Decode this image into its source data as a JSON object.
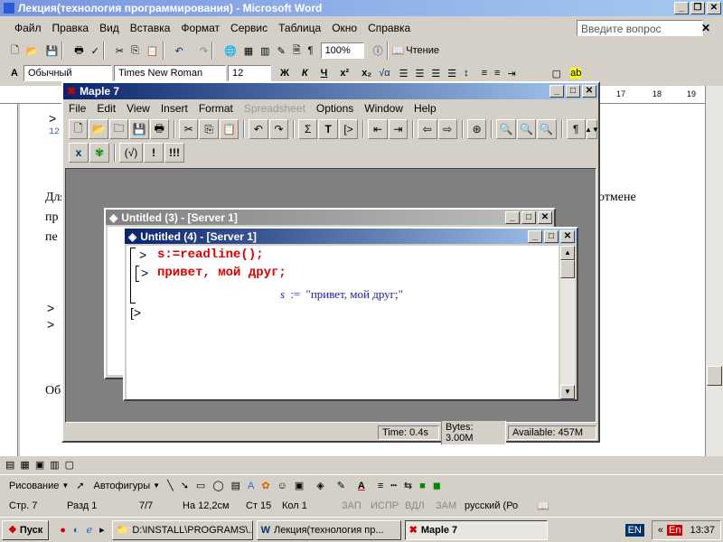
{
  "word": {
    "title": "Лекция(технология программирования) - Microsoft Word",
    "menu": [
      "Файл",
      "Правка",
      "Вид",
      "Вставка",
      "Формат",
      "Сервис",
      "Таблица",
      "Окно",
      "Справка"
    ],
    "ask_placeholder": "Введите вопрос",
    "zoom": "100%",
    "read_label": "Чтение",
    "style": "Обычный",
    "font": "Times New Roman",
    "size": "12",
    "fmt": {
      "bold": "Ж",
      "italic": "К",
      "underline": "Ч"
    },
    "ruler_nums": [
      "17",
      "18",
      "19"
    ],
    "doc": {
      "frag1": "отмене",
      "frag2": "пр",
      "frag3": "пе",
      "frag4": "Для",
      "frag5": "Об",
      "prompt": ">",
      "num": "12"
    },
    "draw_label": "Рисование",
    "autoshapes": "Автофигуры",
    "status": {
      "page": "Стр. 7",
      "section": "Разд 1",
      "pages": "7/7",
      "at": "На 12,2см",
      "line": "Ст 15",
      "col": "Кол 1",
      "rec": "ЗАП",
      "trk": "ИСПР",
      "ext": "ВДЛ",
      "ovr": "ЗАМ",
      "lang": "русский (Ро"
    }
  },
  "maple": {
    "title": "Maple 7",
    "menu": [
      "File",
      "Edit",
      "View",
      "Insert",
      "Format",
      "Spreadsheet",
      "Options",
      "Window",
      "Help"
    ],
    "tb2": {
      "b1": "x",
      "b3": "(√)",
      "b4": "!",
      "b5": "!!!"
    },
    "status": {
      "time": "Time:   0.4s",
      "bytes": "Bytes: 3.00M",
      "avail": "Available: 457M"
    },
    "win3": {
      "title": "Untitled (3) - [Server 1]"
    },
    "win4": {
      "title": "Untitled (4) - [Server 1]",
      "line1": "s:=readline();",
      "line2": "привет, мой друг;",
      "output_var": "s",
      "output_op": ":=",
      "output_val": "\"привет, мой друг;\"",
      "prompt": ">"
    }
  },
  "taskbar": {
    "start": "Пуск",
    "tasks": [
      "D:\\INSTALL\\PROGRAMS\\...",
      "Лекция(технология пр...",
      "Maple 7"
    ],
    "lang": "EN",
    "lang2": "En",
    "time": "13:37"
  }
}
